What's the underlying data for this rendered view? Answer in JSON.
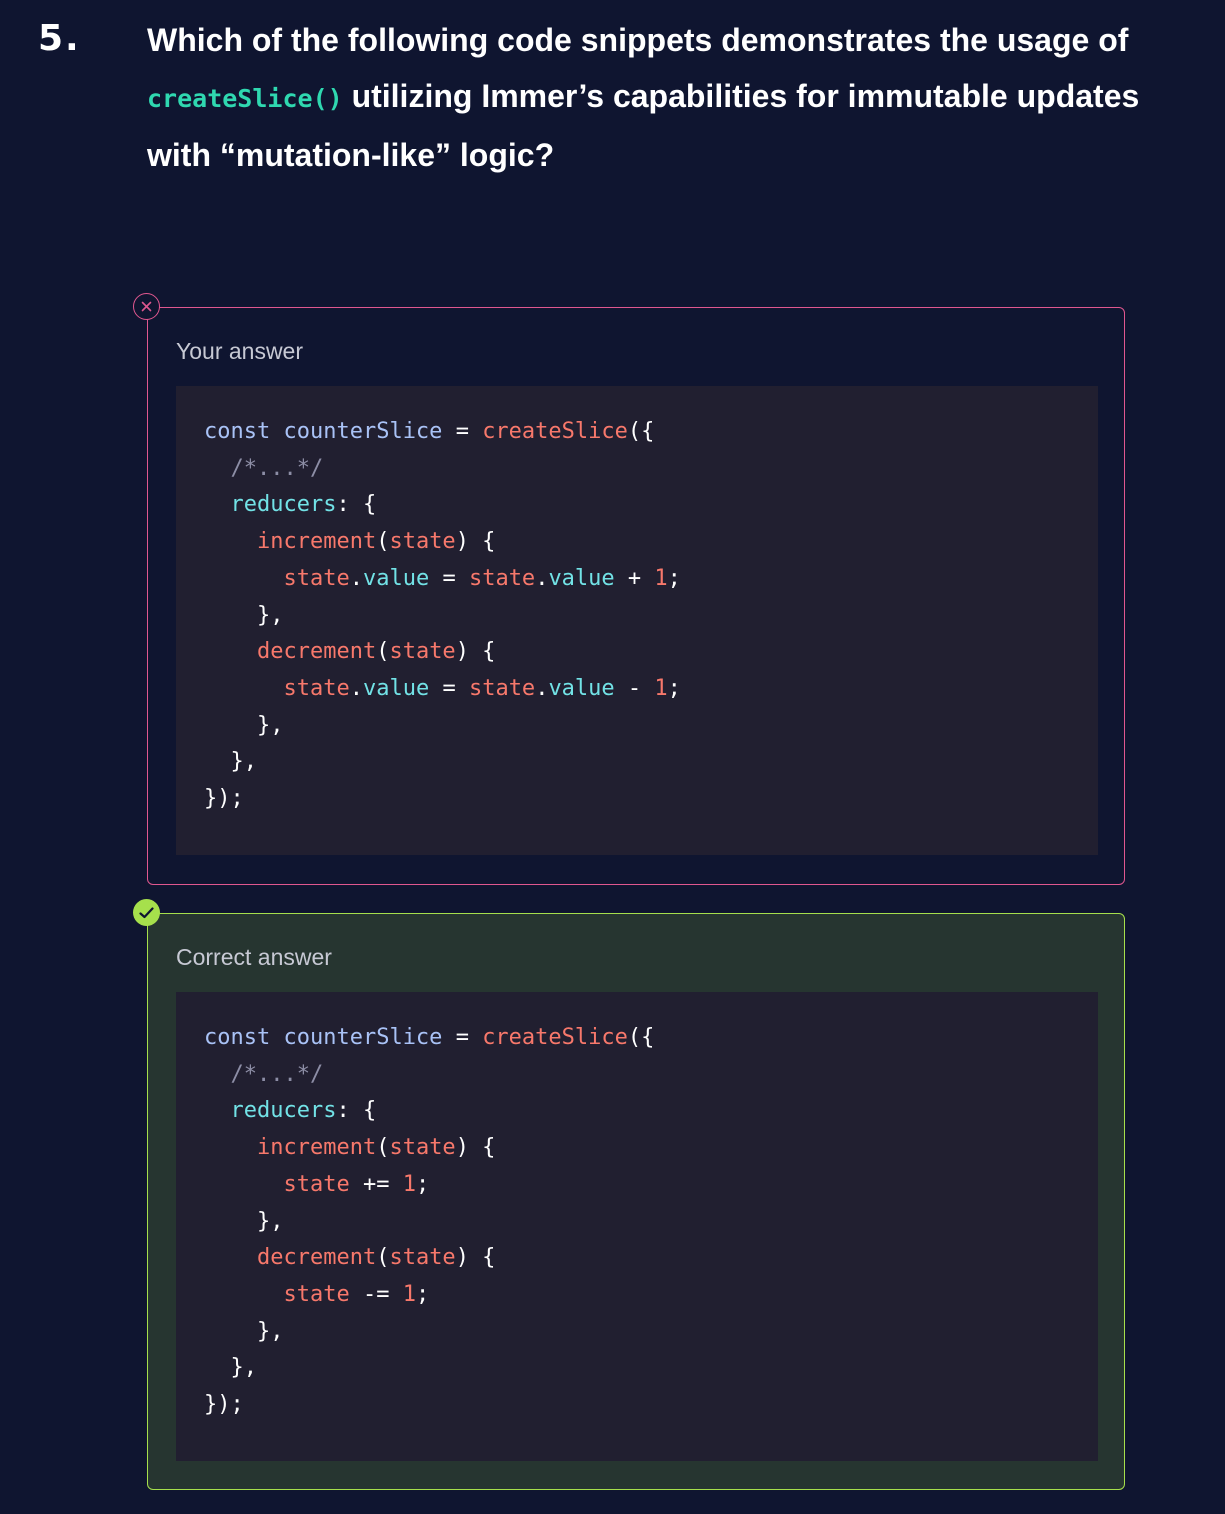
{
  "question": {
    "number": "5.",
    "text_before": "Which of the following code snippets demonstrates the usage of ",
    "inline_code": "createSlice()",
    "text_after": " utilizing Immer’s capabilities for immutable updates with “mutation-like” logic?"
  },
  "your_answer": {
    "label": "Your answer",
    "status_icon": "x-icon",
    "status_color": "#e0578f",
    "code": {
      "kw_const": "const",
      "var_name": "counterSlice",
      "eq": "=",
      "fn_create": "createSlice",
      "open": "({",
      "comment": "/*...*/",
      "reducers": "reducers",
      "colon_brace": ": {",
      "fn_increment": "increment",
      "fn_decrement": "decrement",
      "param": "state",
      "paren_open": "(",
      "paren_close_brace": ") {",
      "state": "state",
      "dot": ".",
      "value": "value",
      "plus": "+",
      "minus": "-",
      "one": "1",
      "semi": ";",
      "close_fn": "},",
      "close_reducers": "},",
      "close_all": "});"
    }
  },
  "correct_answer": {
    "label": "Correct answer",
    "status_icon": "check-icon",
    "status_color": "#a6e04c",
    "code": {
      "kw_const": "const",
      "var_name": "counterSlice",
      "eq": "=",
      "fn_create": "createSlice",
      "open": "({",
      "comment": "/*...*/",
      "reducers": "reducers",
      "colon_brace": ": {",
      "fn_increment": "increment",
      "fn_decrement": "decrement",
      "param": "state",
      "paren_open": "(",
      "paren_close_brace": ") {",
      "state": "state",
      "plus_eq": "+=",
      "minus_eq": "-=",
      "one": "1",
      "semi": ";",
      "close_fn": "},",
      "close_reducers": "},",
      "close_all": "});"
    }
  }
}
